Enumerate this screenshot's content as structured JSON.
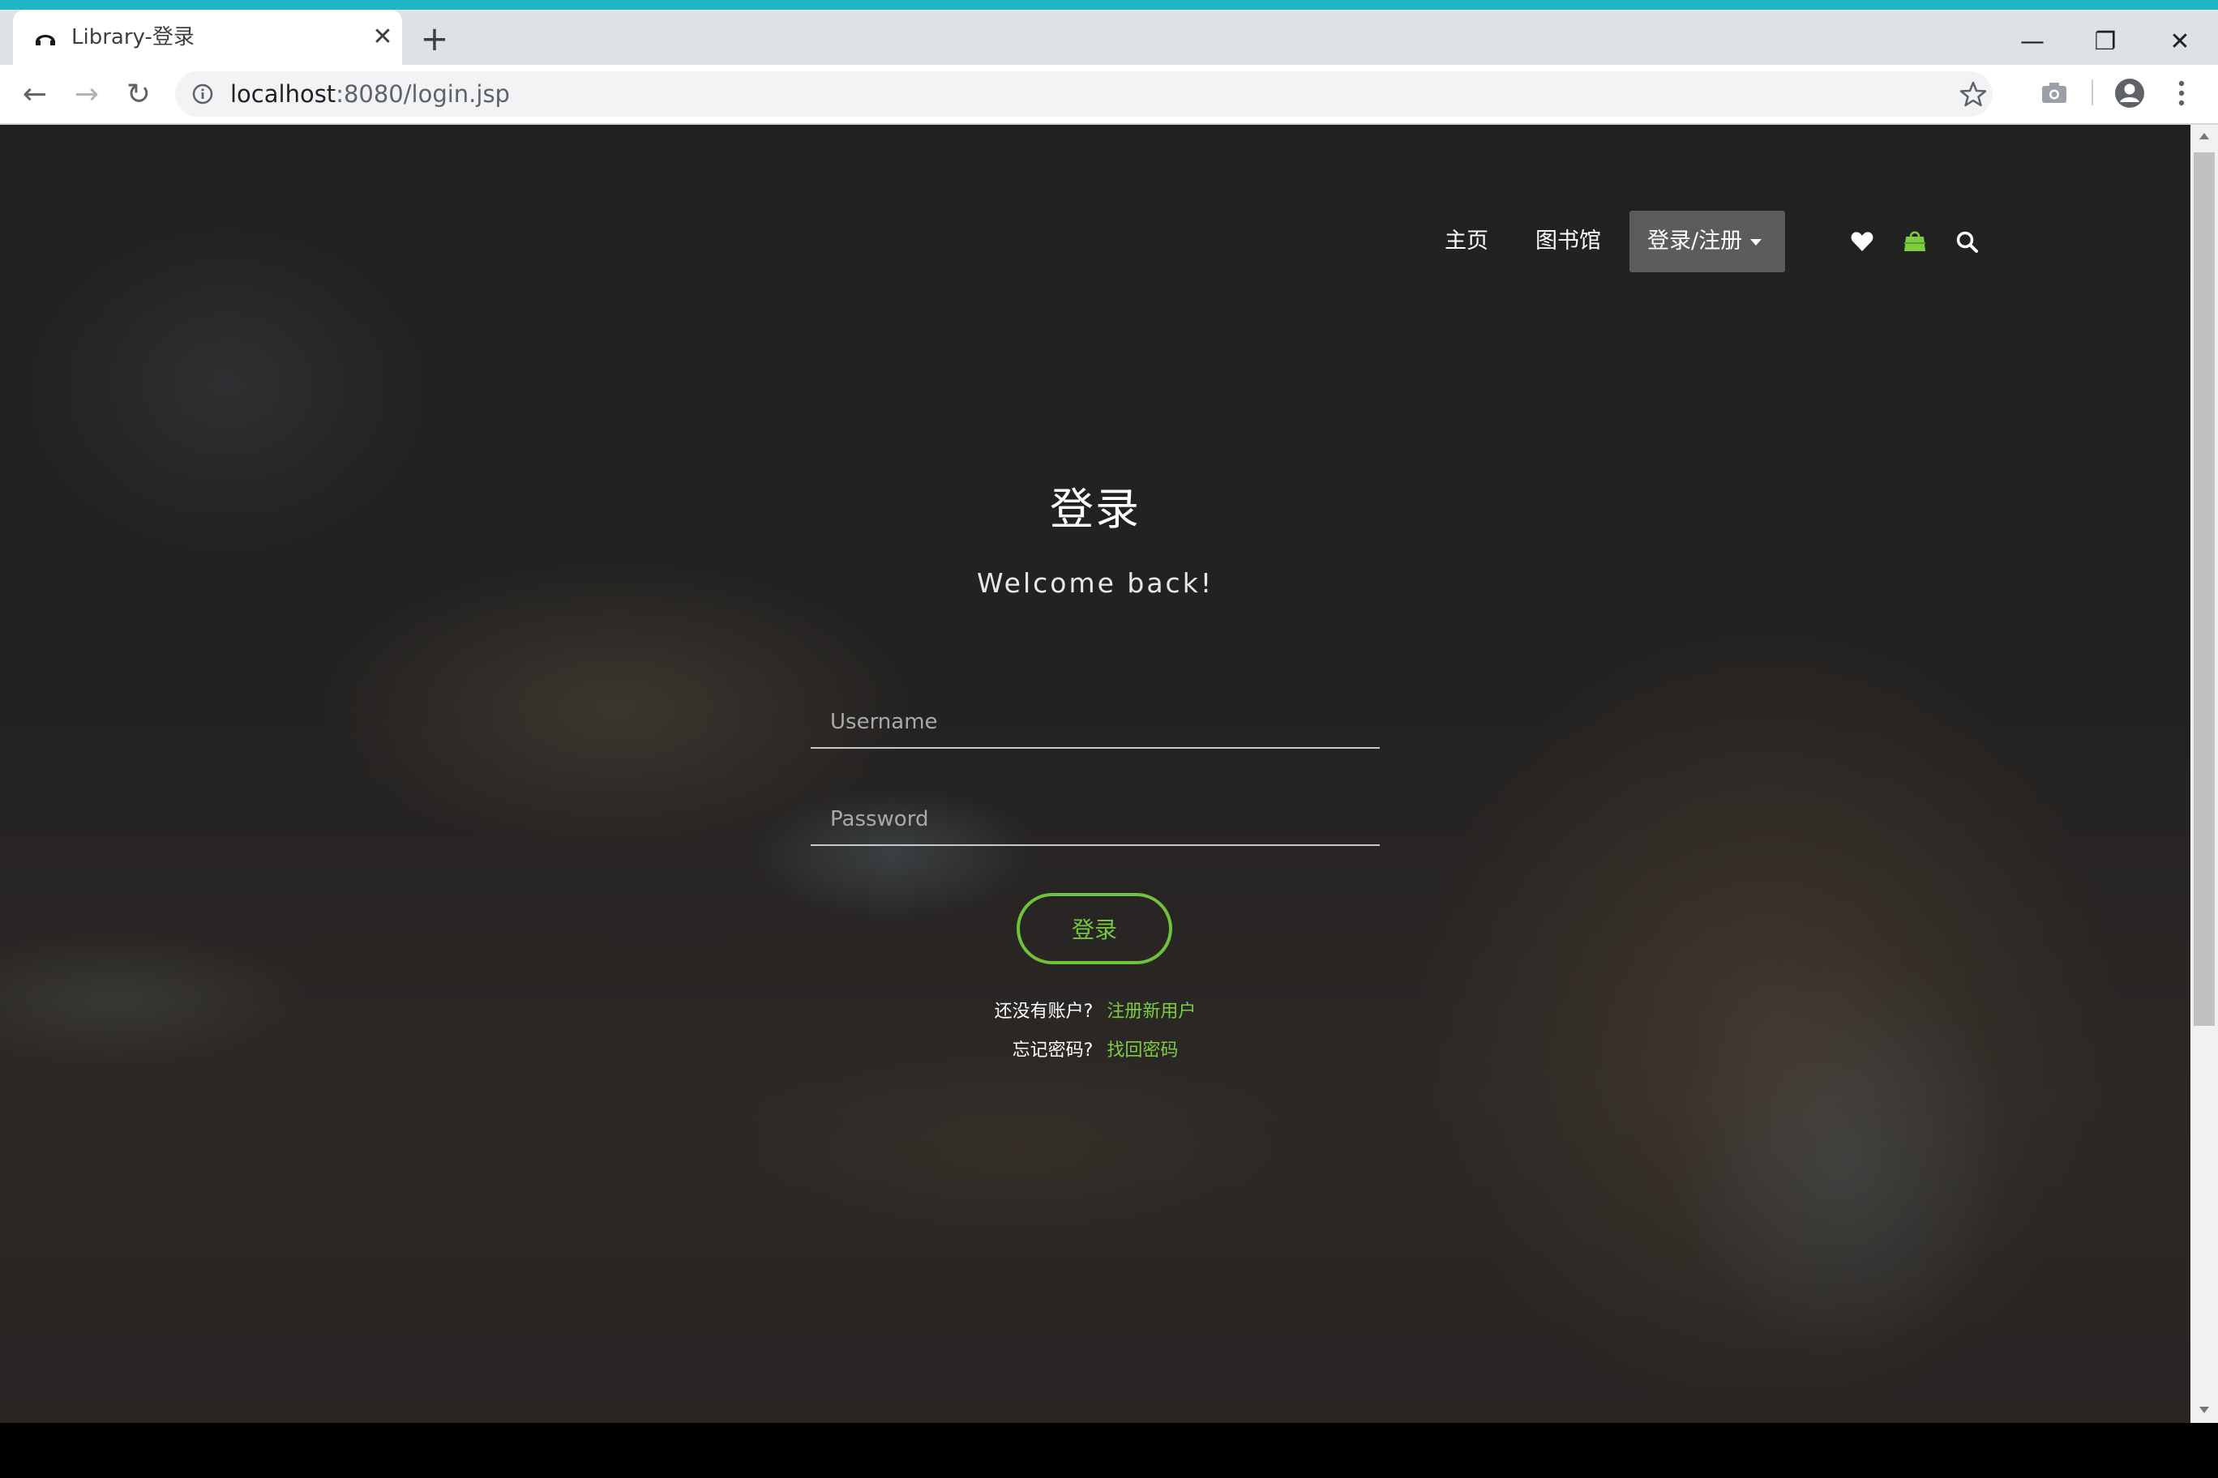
{
  "browser": {
    "tab_title": "Library-登录",
    "tab_close": "✕",
    "new_tab": "+",
    "url_host": "localhost",
    "url_rest": ":8080/login.jsp",
    "window_min": "—",
    "window_max": "❐",
    "window_close": "✕",
    "accent_color": "#1fb5c2"
  },
  "nav": {
    "home": "主页",
    "library": "图书馆",
    "login_register": "登录/注册",
    "icons": [
      "heart-icon",
      "shopping-bag-icon",
      "search-icon"
    ],
    "bag_color": "#7dcc42"
  },
  "login": {
    "title": "登录",
    "subtitle": "Welcome back!",
    "username_placeholder": "Username",
    "password_placeholder": "Password",
    "submit_label": "登录",
    "no_account_text": "还没有账户?",
    "register_link": "注册新用户",
    "forgot_text": "忘记密码?",
    "recover_link": "找回密码",
    "accent_color": "#74c63c"
  }
}
